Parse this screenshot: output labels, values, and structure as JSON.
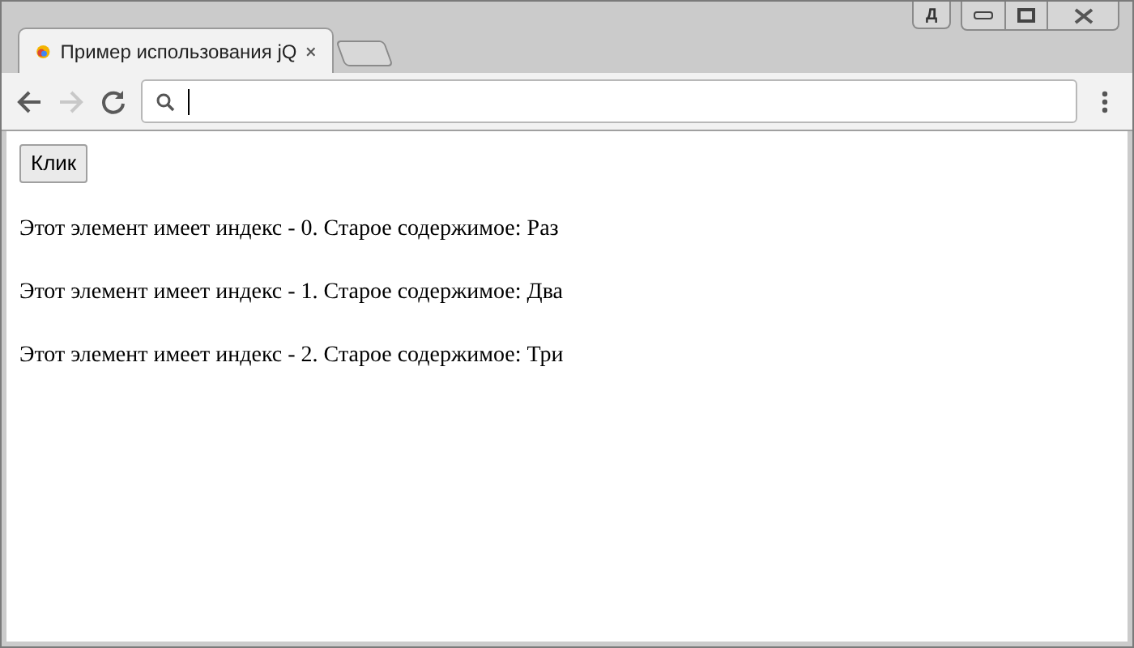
{
  "window": {
    "profile_badge": "Д"
  },
  "tabs": [
    {
      "title": "Пример использования jQ",
      "selected": true
    }
  ],
  "toolbar": {
    "back_disabled": false,
    "forward_disabled": true
  },
  "page": {
    "button": "Клик",
    "paragraphs": [
      "Этот элемент имеет индекс - 0. Старое содержимое: Раз",
      "Этот элемент имеет индекс - 1. Старое содержимое: Два",
      "Этот элемент имеет индекс - 2. Старое содержимое: Три"
    ]
  }
}
